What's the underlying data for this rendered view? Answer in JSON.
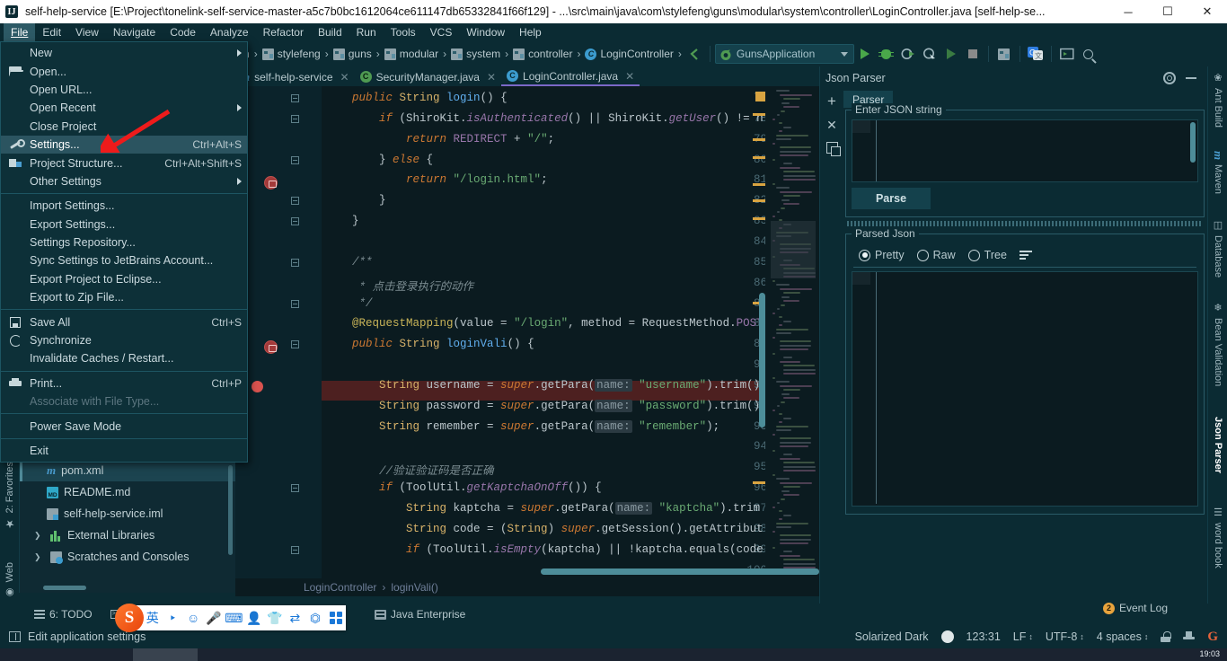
{
  "window": {
    "title": "self-help-service [E:\\Project\\tonelink-self-service-master-a5c7b0bc1612064ce611147db65332841f66f129] - ...\\src\\main\\java\\com\\stylefeng\\guns\\modular\\system\\controller\\LoginController.java [self-help-se...",
    "minimize": "─",
    "maximize": "☐",
    "close": "✕"
  },
  "menubar": {
    "items": [
      {
        "label": "File",
        "mnemonic": "F"
      },
      {
        "label": "Edit",
        "mnemonic": "E"
      },
      {
        "label": "View",
        "mnemonic": "V"
      },
      {
        "label": "Navigate",
        "mnemonic": "N"
      },
      {
        "label": "Code",
        "mnemonic": "C"
      },
      {
        "label": "Analyze",
        "mnemonic": "A"
      },
      {
        "label": "Refactor",
        "mnemonic": "R"
      },
      {
        "label": "Build",
        "mnemonic": "B"
      },
      {
        "label": "Run",
        "mnemonic": "R"
      },
      {
        "label": "Tools",
        "mnemonic": "T"
      },
      {
        "label": "VCS",
        "mnemonic": "V"
      },
      {
        "label": "Window",
        "mnemonic": "W"
      },
      {
        "label": "Help",
        "mnemonic": "H"
      }
    ]
  },
  "file_menu": {
    "items": [
      {
        "label": "New",
        "shortcut": "",
        "submenu": true,
        "icon": "",
        "disabled": false,
        "selected": false
      },
      {
        "label": "Open...",
        "shortcut": "",
        "submenu": false,
        "icon": "open-folder",
        "disabled": false,
        "selected": false
      },
      {
        "label": "Open URL...",
        "shortcut": "",
        "submenu": false,
        "icon": "",
        "disabled": false,
        "selected": false
      },
      {
        "label": "Open Recent",
        "shortcut": "",
        "submenu": true,
        "icon": "",
        "disabled": false,
        "selected": false
      },
      {
        "label": "Close Project",
        "shortcut": "",
        "submenu": false,
        "icon": "",
        "disabled": false,
        "selected": false
      },
      {
        "label": "Settings...",
        "shortcut": "Ctrl+Alt+S",
        "submenu": false,
        "icon": "wrench",
        "disabled": false,
        "selected": true
      },
      {
        "label": "Project Structure...",
        "shortcut": "Ctrl+Alt+Shift+S",
        "submenu": false,
        "icon": "project",
        "disabled": false,
        "selected": false
      },
      {
        "label": "Other Settings",
        "shortcut": "",
        "submenu": true,
        "icon": "",
        "disabled": false,
        "selected": false
      },
      {
        "separator": true
      },
      {
        "label": "Import Settings...",
        "shortcut": "",
        "submenu": false,
        "icon": "",
        "disabled": false,
        "selected": false
      },
      {
        "label": "Export Settings...",
        "shortcut": "",
        "submenu": false,
        "icon": "",
        "disabled": false,
        "selected": false
      },
      {
        "label": "Settings Repository...",
        "shortcut": "",
        "submenu": false,
        "icon": "",
        "disabled": false,
        "selected": false
      },
      {
        "label": "Sync Settings to JetBrains Account...",
        "shortcut": "",
        "submenu": false,
        "icon": "",
        "disabled": false,
        "selected": false
      },
      {
        "label": "Export Project to Eclipse...",
        "shortcut": "",
        "submenu": false,
        "icon": "",
        "disabled": false,
        "selected": false
      },
      {
        "label": "Export to Zip File...",
        "shortcut": "",
        "submenu": false,
        "icon": "",
        "disabled": false,
        "selected": false
      },
      {
        "separator": true
      },
      {
        "label": "Save All",
        "shortcut": "Ctrl+S",
        "submenu": false,
        "icon": "save",
        "disabled": false,
        "selected": false
      },
      {
        "label": "Synchronize",
        "shortcut": "",
        "submenu": false,
        "icon": "sync",
        "disabled": false,
        "selected": false
      },
      {
        "label": "Invalidate Caches / Restart...",
        "shortcut": "",
        "submenu": false,
        "icon": "",
        "disabled": false,
        "selected": false
      },
      {
        "separator": true
      },
      {
        "label": "Print...",
        "shortcut": "Ctrl+P",
        "submenu": false,
        "icon": "print",
        "disabled": false,
        "selected": false
      },
      {
        "label": "Associate with File Type...",
        "shortcut": "",
        "submenu": false,
        "icon": "",
        "disabled": true,
        "selected": false
      },
      {
        "separator": true
      },
      {
        "label": "Power Save Mode",
        "shortcut": "",
        "submenu": false,
        "icon": "",
        "disabled": false,
        "selected": false
      },
      {
        "separator": true
      },
      {
        "label": "Exit",
        "shortcut": "",
        "submenu": false,
        "icon": "",
        "disabled": false,
        "selected": false
      }
    ]
  },
  "navbar": {
    "crumbs": [
      {
        "label": "n",
        "icon": "truncated"
      },
      {
        "label": "stylefeng",
        "icon": "folder-icon"
      },
      {
        "label": "guns",
        "icon": "folder-icon"
      },
      {
        "label": "modular",
        "icon": "folder-icon"
      },
      {
        "label": "system",
        "icon": "folder-icon"
      },
      {
        "label": "controller",
        "icon": "folder-icon"
      },
      {
        "label": "LoginController",
        "icon": "class-icon"
      }
    ]
  },
  "toolbar": {
    "run_config": "GunsApplication",
    "buttons": [
      "run-button",
      "debug-button",
      "run-coverage-button",
      "profile-button",
      "run-dim-button",
      "stop-button",
      "project-structure-button",
      "translate-button",
      "terminal-button",
      "search-button"
    ]
  },
  "editor_tabs": [
    {
      "label": "self-help-service",
      "icon": "maven-icon",
      "active": false
    },
    {
      "label": "SecurityManager.java",
      "icon": "class-green-icon",
      "active": false
    },
    {
      "label": "LoginController.java",
      "icon": "class-icon",
      "active": true
    }
  ],
  "left_strip": [
    {
      "label": "2: Favorites",
      "icon": "star-icon"
    },
    {
      "label": "Web",
      "icon": "globe-icon"
    }
  ],
  "project_tree": [
    {
      "label": "pom.xml",
      "icon": "maven-icon",
      "selected": true,
      "expandable": false
    },
    {
      "label": "README.md",
      "icon": "markdown-icon",
      "selected": false,
      "expandable": false
    },
    {
      "label": "self-help-service.iml",
      "icon": "iml-icon",
      "selected": false,
      "expandable": false
    },
    {
      "label": "External Libraries",
      "icon": "library-icon",
      "selected": false,
      "expandable": true
    },
    {
      "label": "Scratches and Consoles",
      "icon": "scratch-icon",
      "selected": false,
      "expandable": true
    }
  ],
  "editor": {
    "first_line": 77,
    "breakpoint_line": 91,
    "lines": [
      {
        "n": 77,
        "tokens": [
          {
            "t": "    ",
            "c": "pln"
          },
          {
            "t": "public ",
            "c": "kw"
          },
          {
            "t": "String ",
            "c": "type"
          },
          {
            "t": "login",
            "c": "mth"
          },
          {
            "t": "() {",
            "c": "pln"
          }
        ]
      },
      {
        "n": 78,
        "tokens": [
          {
            "t": "        ",
            "c": "pln"
          },
          {
            "t": "if ",
            "c": "kw"
          },
          {
            "t": "(ShiroKit.",
            "c": "pln"
          },
          {
            "t": "isAuthenticated",
            "c": "stat"
          },
          {
            "t": "() ",
            "c": "pln"
          },
          {
            "t": "|| ",
            "c": "pln"
          },
          {
            "t": "ShiroKit.",
            "c": "pln"
          },
          {
            "t": "getUser",
            "c": "stat"
          },
          {
            "t": "() != n",
            "c": "pln"
          }
        ]
      },
      {
        "n": 79,
        "tokens": [
          {
            "t": "            ",
            "c": "pln"
          },
          {
            "t": "return ",
            "c": "kw"
          },
          {
            "t": "REDIRECT",
            "c": "fld"
          },
          {
            "t": " + ",
            "c": "pln"
          },
          {
            "t": "\"/\"",
            "c": "str"
          },
          {
            "t": ";",
            "c": "pln"
          }
        ]
      },
      {
        "n": 80,
        "tokens": [
          {
            "t": "        } ",
            "c": "pln"
          },
          {
            "t": "else ",
            "c": "kw"
          },
          {
            "t": "{",
            "c": "pln"
          }
        ]
      },
      {
        "n": 81,
        "tokens": [
          {
            "t": "            ",
            "c": "pln"
          },
          {
            "t": "return ",
            "c": "kw"
          },
          {
            "t": "\"/login.html\"",
            "c": "str"
          },
          {
            "t": ";",
            "c": "pln"
          }
        ]
      },
      {
        "n": 82,
        "tokens": [
          {
            "t": "        }",
            "c": "pln"
          }
        ]
      },
      {
        "n": 83,
        "tokens": [
          {
            "t": "    }",
            "c": "pln"
          }
        ]
      },
      {
        "n": 84,
        "tokens": []
      },
      {
        "n": 85,
        "tokens": [
          {
            "t": "    /**",
            "c": "cmt"
          }
        ]
      },
      {
        "n": 86,
        "tokens": [
          {
            "t": "     * 点击登录执行的动作",
            "c": "cmt"
          }
        ]
      },
      {
        "n": 87,
        "tokens": [
          {
            "t": "     */",
            "c": "cmt"
          }
        ]
      },
      {
        "n": 88,
        "tokens": [
          {
            "t": "    ",
            "c": "pln"
          },
          {
            "t": "@RequestMapping",
            "c": "ann"
          },
          {
            "t": "(value = ",
            "c": "pln"
          },
          {
            "t": "\"/login\"",
            "c": "str"
          },
          {
            "t": ", method = RequestMethod.",
            "c": "pln"
          },
          {
            "t": "POST",
            "c": "fld"
          }
        ]
      },
      {
        "n": 89,
        "tokens": [
          {
            "t": "    ",
            "c": "pln"
          },
          {
            "t": "public ",
            "c": "kw"
          },
          {
            "t": "String ",
            "c": "type"
          },
          {
            "t": "loginVali",
            "c": "mth"
          },
          {
            "t": "() {",
            "c": "pln"
          }
        ]
      },
      {
        "n": 90,
        "tokens": []
      },
      {
        "n": 91,
        "tokens": [
          {
            "t": "        ",
            "c": "pln"
          },
          {
            "t": "String ",
            "c": "type"
          },
          {
            "t": "username = ",
            "c": "pln"
          },
          {
            "t": "super",
            "c": "kw"
          },
          {
            "t": ".getPara(",
            "c": "pln"
          },
          {
            "t": "name:",
            "c": "hint"
          },
          {
            "t": " ",
            "c": "pln"
          },
          {
            "t": "\"username\"",
            "c": "str"
          },
          {
            "t": ").trim()",
            "c": "pln"
          }
        ]
      },
      {
        "n": 92,
        "tokens": [
          {
            "t": "        ",
            "c": "pln"
          },
          {
            "t": "String ",
            "c": "type"
          },
          {
            "t": "password = ",
            "c": "pln"
          },
          {
            "t": "super",
            "c": "kw"
          },
          {
            "t": ".getPara(",
            "c": "pln"
          },
          {
            "t": "name:",
            "c": "hint"
          },
          {
            "t": " ",
            "c": "pln"
          },
          {
            "t": "\"password\"",
            "c": "str"
          },
          {
            "t": ").trim()",
            "c": "pln"
          }
        ]
      },
      {
        "n": 93,
        "tokens": [
          {
            "t": "        ",
            "c": "pln"
          },
          {
            "t": "String ",
            "c": "type"
          },
          {
            "t": "remember = ",
            "c": "pln"
          },
          {
            "t": "super",
            "c": "kw"
          },
          {
            "t": ".getPara(",
            "c": "pln"
          },
          {
            "t": "name:",
            "c": "hint"
          },
          {
            "t": " ",
            "c": "pln"
          },
          {
            "t": "\"remember\"",
            "c": "str"
          },
          {
            "t": ");",
            "c": "pln"
          }
        ]
      },
      {
        "n": 94,
        "tokens": []
      },
      {
        "n": 95,
        "tokens": [
          {
            "t": "        //验证验证码是否正确",
            "c": "cmt"
          }
        ]
      },
      {
        "n": 96,
        "tokens": [
          {
            "t": "        ",
            "c": "pln"
          },
          {
            "t": "if ",
            "c": "kw"
          },
          {
            "t": "(ToolUtil.",
            "c": "pln"
          },
          {
            "t": "getKaptchaOnOff",
            "c": "stat"
          },
          {
            "t": "()) {",
            "c": "pln"
          }
        ]
      },
      {
        "n": 97,
        "tokens": [
          {
            "t": "            ",
            "c": "pln"
          },
          {
            "t": "String ",
            "c": "type"
          },
          {
            "t": "kaptcha = ",
            "c": "pln"
          },
          {
            "t": "super",
            "c": "kw"
          },
          {
            "t": ".getPara(",
            "c": "pln"
          },
          {
            "t": "name:",
            "c": "hint"
          },
          {
            "t": " ",
            "c": "pln"
          },
          {
            "t": "\"kaptcha\"",
            "c": "str"
          },
          {
            "t": ").trim",
            "c": "pln"
          }
        ]
      },
      {
        "n": 98,
        "tokens": [
          {
            "t": "            ",
            "c": "pln"
          },
          {
            "t": "String ",
            "c": "type"
          },
          {
            "t": "code = (",
            "c": "pln"
          },
          {
            "t": "String",
            "c": "type"
          },
          {
            "t": ") ",
            "c": "pln"
          },
          {
            "t": "super",
            "c": "kw"
          },
          {
            "t": ".getSession().getAttribut",
            "c": "pln"
          }
        ]
      },
      {
        "n": 99,
        "tokens": [
          {
            "t": "            ",
            "c": "pln"
          },
          {
            "t": "if ",
            "c": "kw"
          },
          {
            "t": "(ToolUtil.",
            "c": "pln"
          },
          {
            "t": "isEmpty",
            "c": "stat"
          },
          {
            "t": "(kaptcha) || !kaptcha.equals(code",
            "c": "pln"
          }
        ]
      },
      {
        "n": 100,
        "tokens": []
      }
    ],
    "breadcrumb": [
      "LoginController",
      "loginVali()"
    ]
  },
  "json_parser": {
    "title": "Json Parser",
    "tab": "Parser",
    "input_group_label": "Enter JSON string",
    "input_value": "",
    "parse_button": "Parse",
    "output_group_label": "Parsed Json",
    "view_modes": [
      {
        "label": "Pretty",
        "selected": true
      },
      {
        "label": "Raw",
        "selected": false
      },
      {
        "label": "Tree",
        "selected": false
      }
    ],
    "actions": [
      "add-icon",
      "close-icon",
      "copy-icon"
    ],
    "header_actions": [
      "gear-icon",
      "minimize-icon"
    ]
  },
  "right_strip": [
    {
      "label": "Ant Build",
      "icon": "ant-icon",
      "active": false
    },
    {
      "label": "Maven",
      "icon": "maven-icon",
      "active": false
    },
    {
      "label": "Database",
      "icon": "database-icon",
      "active": false
    },
    {
      "label": "Bean Validation",
      "icon": "bean-icon",
      "active": false
    },
    {
      "label": "Json Parser",
      "icon": "json-icon",
      "active": true
    },
    {
      "label": "word book",
      "icon": "wordbook-icon",
      "active": false
    }
  ],
  "bottom_strip": [
    {
      "label": "6: TODO",
      "icon": "todo-icon"
    },
    {
      "label": "T",
      "icon": "terminal-icon"
    },
    {
      "label": "Java Enterprise",
      "icon": "enterprise-icon"
    }
  ],
  "event_log": {
    "label": "Event Log",
    "count": "2"
  },
  "status_bar": {
    "message": "Edit application settings",
    "theme": "Solarized Dark",
    "caret": "123:31",
    "line_separator": "LF",
    "encoding": "UTF-8",
    "indent": "4 spaces",
    "icons": [
      "lock-icon",
      "hat-icon",
      "google-icon"
    ]
  },
  "ime": {
    "name": "sogou-ime-toolbar",
    "logo": "S",
    "items": [
      "chinese-english-toggle",
      "punctuation-icon",
      "emoji-icon",
      "voice-icon",
      "soft-keyboard-icon",
      "user-icon",
      "skin-icon",
      "translate-icon",
      "screenshot-icon",
      "apps-icon"
    ],
    "mode_label": "英"
  },
  "annotation": {
    "type": "red-arrow",
    "points_to": "Settings..."
  },
  "taskbar": {
    "clock": "19:03"
  }
}
